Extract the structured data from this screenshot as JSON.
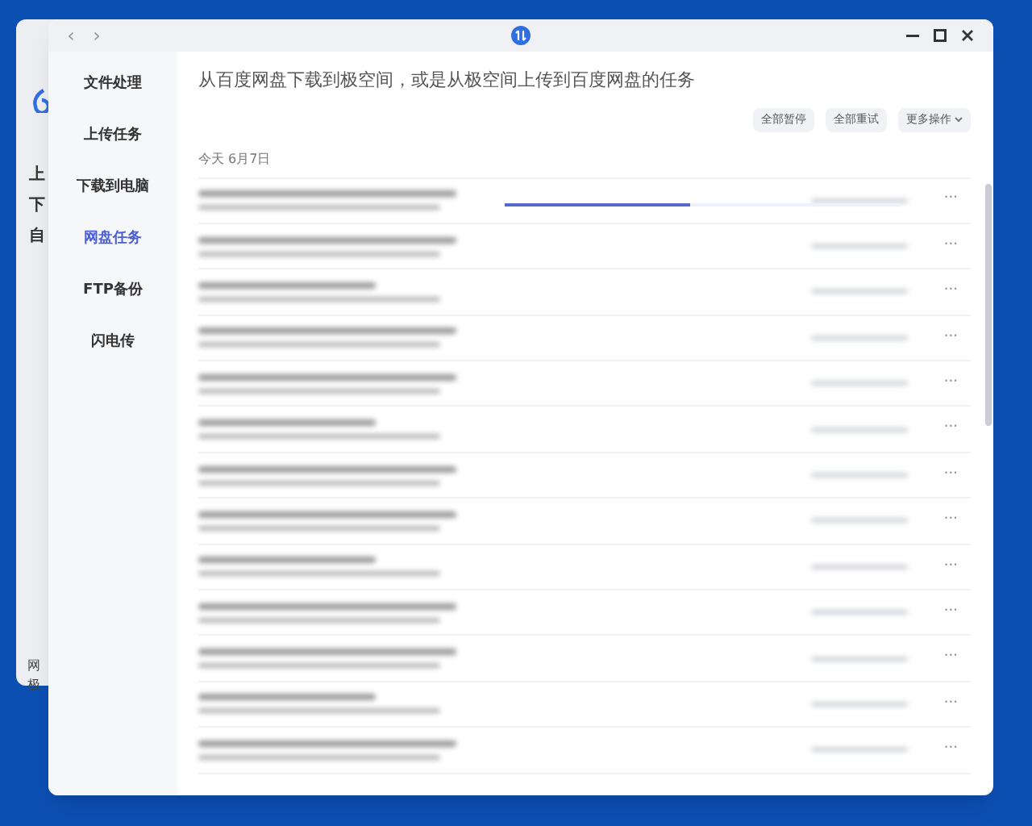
{
  "background_window": {
    "texts": [
      "上",
      "下",
      "自"
    ],
    "footer": [
      "网",
      "极"
    ]
  },
  "window": {
    "nav_back": "‹",
    "nav_forward": "›"
  },
  "sidebar": {
    "items": [
      {
        "label": "文件处理",
        "selected": false
      },
      {
        "label": "上传任务",
        "selected": false
      },
      {
        "label": "下载到电脑",
        "selected": false
      },
      {
        "label": "网盘任务",
        "selected": true
      },
      {
        "label": "FTP备份",
        "selected": false
      },
      {
        "label": "闪电传",
        "selected": false
      }
    ]
  },
  "content": {
    "description": "从百度网盘下载到极空间，或是从极空间上传到百度网盘的任务",
    "buttons": [
      {
        "label": "全部暂停",
        "kind": "plain"
      },
      {
        "label": "全部重试",
        "kind": "plain"
      },
      {
        "label": "更多操作",
        "kind": "dropdown"
      }
    ],
    "date_header": "今天 6月7日",
    "rows": [
      {
        "kind": "active",
        "level": 0.47,
        "more": "···"
      },
      {
        "kind": "plain",
        "more": "···"
      },
      {
        "kind": "plain",
        "more": "···"
      },
      {
        "kind": "plain",
        "more": "···"
      },
      {
        "kind": "plain",
        "more": "···"
      },
      {
        "kind": "plain",
        "more": "···"
      },
      {
        "kind": "plain",
        "more": "···"
      },
      {
        "kind": "plain",
        "more": "···"
      },
      {
        "kind": "plain",
        "more": "···"
      },
      {
        "kind": "plain",
        "more": "···"
      },
      {
        "kind": "plain",
        "more": "···"
      },
      {
        "kind": "plain",
        "more": "···"
      },
      {
        "kind": "plain",
        "more": "···"
      }
    ]
  }
}
